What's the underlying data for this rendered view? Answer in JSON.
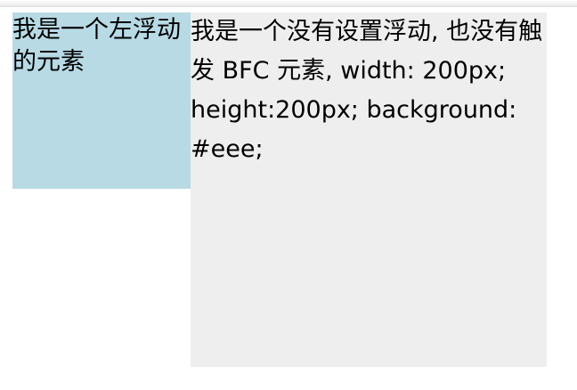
{
  "left_float": {
    "text": "我是一个左浮动的元素",
    "background": "#b8dae5"
  },
  "non_float": {
    "text": "我是一个没有设置浮动, 也没有触发 BFC 元素, width: 200px; height:200px; background: #eee;",
    "background": "#eeeeee"
  }
}
